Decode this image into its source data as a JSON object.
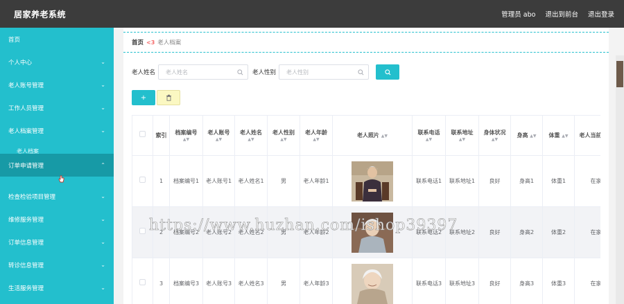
{
  "app": {
    "title": "居家养老系统",
    "user": "管理员 abo",
    "back_link": "退出到前台",
    "logout": "退出登录"
  },
  "sidebar": {
    "items": [
      {
        "label": "首页",
        "chevron": ""
      },
      {
        "label": "个人中心",
        "chevron": "⌄"
      },
      {
        "label": "老人账号管理",
        "chevron": "⌄"
      },
      {
        "label": "工作人员管理",
        "chevron": "⌄"
      },
      {
        "label": "老人档案管理",
        "chevron": "⌄"
      },
      {
        "label": "订单申请管理",
        "chevron": "⌃"
      },
      {
        "label": "检查检验项目管理",
        "chevron": "⌄"
      },
      {
        "label": "维修服务管理",
        "chevron": "⌄"
      },
      {
        "label": "订单信息管理",
        "chevron": "⌄"
      },
      {
        "label": "转诊信息管理",
        "chevron": "⌄"
      },
      {
        "label": "生活服务管理",
        "chevron": "⌄"
      }
    ],
    "sub_item": "老人档案"
  },
  "breadcrumb": {
    "home": "首页",
    "sep": "<3",
    "current": "老人档案"
  },
  "search": {
    "name_label": "老人姓名",
    "name_placeholder": "老人姓名",
    "gender_label": "老人性别",
    "gender_placeholder": "老人性别"
  },
  "table": {
    "headers": [
      "索引",
      "档案编号",
      "老人账号",
      "老人姓名",
      "老人性别",
      "老人年龄",
      "老人照片",
      "联系电话",
      "联系地址",
      "身体状况",
      "身高",
      "体重",
      "老人当前状态"
    ],
    "rows": [
      {
        "index": "1",
        "archive_no": "档案编号1",
        "account": "老人账号1",
        "name": "老人姓名1",
        "gender": "男",
        "age": "老人年龄1",
        "phone": "联系电话1",
        "address": "联系地址1",
        "health": "良好",
        "height": "身高1",
        "weight": "体重1",
        "status": "在家"
      },
      {
        "index": "2",
        "archive_no": "档案编号2",
        "account": "老人账号2",
        "name": "老人姓名2",
        "gender": "男",
        "age": "老人年龄2",
        "phone": "联系电话2",
        "address": "联系地址2",
        "health": "良好",
        "height": "身高2",
        "weight": "体重2",
        "status": "在家"
      },
      {
        "index": "3",
        "archive_no": "档案编号3",
        "account": "老人账号3",
        "name": "老人姓名3",
        "gender": "男",
        "age": "老人年龄3",
        "phone": "联系电话3",
        "address": "联系地址3",
        "health": "良好",
        "height": "身高3",
        "weight": "体重3",
        "status": "在家"
      }
    ]
  },
  "watermark": "https://www.huzhan.com/ishop39397",
  "colors": {
    "accent": "#23bfcd",
    "accent_active": "#179aa6",
    "topbar": "#3c3c3c",
    "delete_button": "#fbf8c2"
  }
}
